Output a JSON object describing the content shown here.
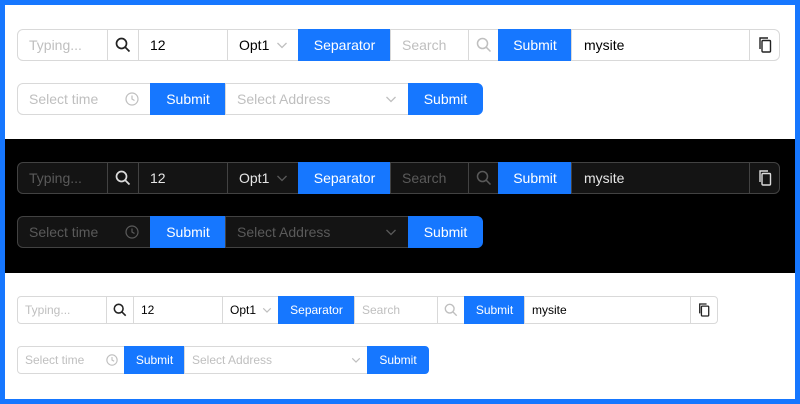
{
  "sections": {
    "light": {
      "row1": {
        "typing_placeholder": "Typing...",
        "number_value": "12",
        "option_value": "Opt1",
        "separator_label": "Separator",
        "search_placeholder": "Search",
        "submit_label": "Submit",
        "site_value": "mysite"
      },
      "row2": {
        "time_placeholder": "Select time",
        "submit_label": "Submit",
        "address_placeholder": "Select Address",
        "submit2_label": "Submit"
      }
    },
    "dark": {
      "row1": {
        "typing_placeholder": "Typing...",
        "number_value": "12",
        "option_value": "Opt1",
        "separator_label": "Separator",
        "search_placeholder": "Search",
        "submit_label": "Submit",
        "site_value": "mysite"
      },
      "row2": {
        "time_placeholder": "Select time",
        "submit_label": "Submit",
        "address_placeholder": "Select Address",
        "submit2_label": "Submit"
      }
    },
    "small": {
      "row1": {
        "typing_placeholder": "Typing...",
        "number_value": "12",
        "option_value": "Opt1",
        "separator_label": "Separator",
        "search_placeholder": "Search",
        "submit_label": "Submit",
        "site_value": "mysite"
      },
      "row2": {
        "time_placeholder": "Select time",
        "submit_label": "Submit",
        "address_placeholder": "Select Address",
        "submit2_label": "Submit"
      }
    }
  },
  "icons": [
    "search-icon",
    "chevron-down-icon",
    "clock-icon",
    "copy-icon"
  ],
  "colors": {
    "primary": "#1677ff",
    "border_light": "#d9d9d9",
    "border_dark": "#424242",
    "dark_background": "#000000"
  }
}
